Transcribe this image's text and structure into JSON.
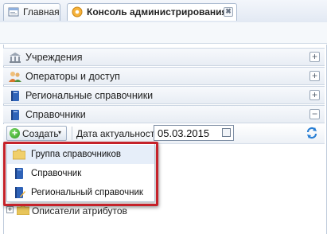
{
  "tabs": [
    {
      "label": "Главная",
      "icon": "home-page-icon",
      "active": false
    },
    {
      "label": "Консоль администрирования",
      "icon": "admin-console-icon",
      "active": true,
      "close": "✖"
    }
  ],
  "accordion": [
    {
      "label": "Учреждения",
      "icon": "institution-icon",
      "toggle": "+"
    },
    {
      "label": "Операторы и доступ",
      "icon": "users-icon",
      "toggle": "+"
    },
    {
      "label": "Региональные справочники",
      "icon": "book-icon",
      "toggle": "+"
    },
    {
      "label": "Справочники",
      "icon": "book-icon",
      "toggle": "−"
    }
  ],
  "toolbar": {
    "create_label": "Создать",
    "create_arrow": "▾",
    "date_label": "Дата актуальности",
    "date_value": "05.03.2015"
  },
  "dropdown": {
    "items": [
      {
        "label": "Группа справочников",
        "icon": "folder-icon"
      },
      {
        "label": "Справочник",
        "icon": "book-icon"
      },
      {
        "label": "Региональный справочник",
        "icon": "book-edit-icon"
      }
    ]
  },
  "tree": {
    "rows": [
      {
        "label": "Описатели атрибутов",
        "expander": "+"
      }
    ]
  },
  "colors": {
    "highlight": "#c5222a",
    "create_green": "#2f9a23",
    "folder": "#e8c55a",
    "book": "#2f63b8"
  }
}
